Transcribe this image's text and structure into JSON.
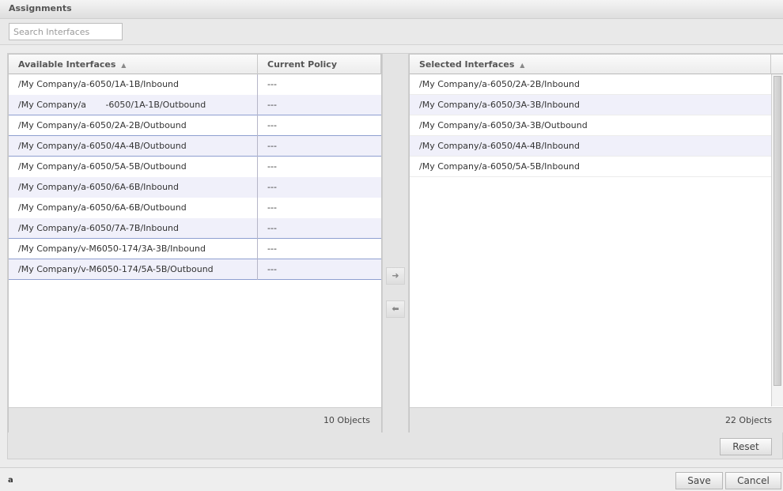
{
  "window": {
    "title": "Assignments"
  },
  "search": {
    "placeholder": "Search Interfaces",
    "value": ""
  },
  "available": {
    "columns": [
      {
        "label": "Available Interfaces",
        "sort": "ascending",
        "sort_icon": "sort-up-icon"
      },
      {
        "label": "Current Policy"
      }
    ],
    "rows": [
      {
        "name": "/My Company/a-6050/1A-1B/Inbound",
        "policy": "---",
        "selected": false
      },
      {
        "name": "/My Company/a       -6050/1A-1B/Outbound",
        "policy": "---",
        "selected": true
      },
      {
        "name": "/My Company/a-6050/2A-2B/Outbound",
        "policy": "---",
        "selected": true
      },
      {
        "name": "/My Company/a-6050/4A-4B/Outbound",
        "policy": "---",
        "selected": true
      },
      {
        "name": "/My Company/a-6050/5A-5B/Outbound",
        "policy": "---",
        "selected": false
      },
      {
        "name": "/My Company/a-6050/6A-6B/Inbound",
        "policy": "---",
        "selected": false
      },
      {
        "name": "/My Company/a-6050/6A-6B/Outbound",
        "policy": "---",
        "selected": false
      },
      {
        "name": "/My Company/a-6050/7A-7B/Inbound",
        "policy": "---",
        "selected": true
      },
      {
        "name": "/My Company/v-M6050-174/3A-3B/Inbound",
        "policy": "---",
        "selected": true
      },
      {
        "name": "/My Company/v-M6050-174/5A-5B/Outbound",
        "policy": "---",
        "selected": true
      }
    ],
    "count_label": "10 Objects"
  },
  "transfer": {
    "add_icon": "arrow-right-icon",
    "remove_icon": "arrow-left-icon",
    "add_glyph": "➜",
    "remove_glyph": "⬅"
  },
  "selected": {
    "columns": [
      {
        "label": "Selected Interfaces",
        "sort": "ascending",
        "sort_icon": "sort-up-icon"
      }
    ],
    "rows": [
      {
        "name": "/My Company/a-6050/2A-2B/Inbound"
      },
      {
        "name": "/My Company/a-6050/3A-3B/Inbound"
      },
      {
        "name": "/My Company/a-6050/3A-3B/Outbound"
      },
      {
        "name": "/My Company/a-6050/4A-4B/Inbound"
      },
      {
        "name": "/My Company/a-6050/5A-5B/Inbound"
      }
    ],
    "count_label": "22 Objects"
  },
  "buttons": {
    "reset": "Reset",
    "save": "Save",
    "cancel": "Cancel"
  },
  "status": {
    "text": "a"
  },
  "colors": {
    "row_alt": "#f0f0fa",
    "selection_border": "#8f9fd0"
  }
}
